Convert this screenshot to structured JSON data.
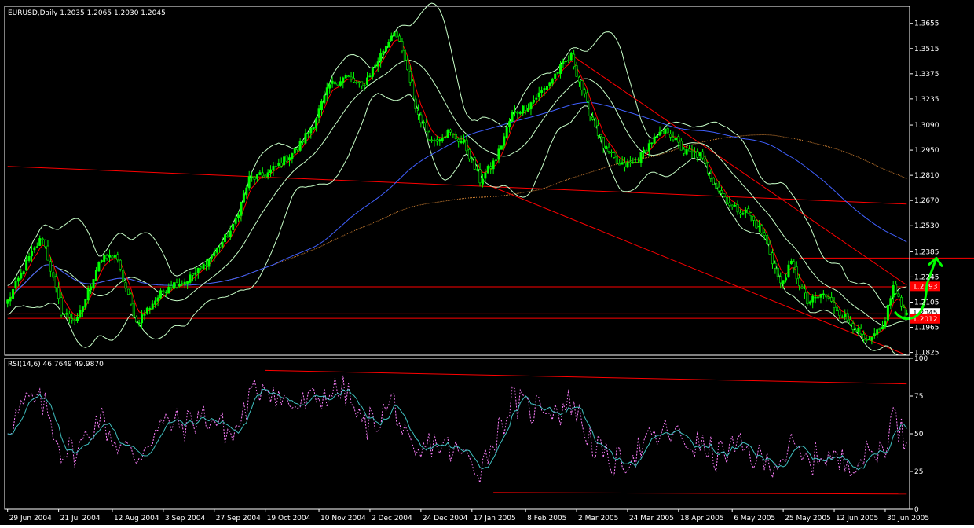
{
  "window": {
    "title": "EURUSD,Daily  1.2035 1.2065 1.2030 1.2045"
  },
  "colors": {
    "background": "#000000",
    "frame": "#ffffff",
    "axis_text": "#ffffff",
    "bull_candle": "#00ff00",
    "bear_candle": "#000000",
    "candle_outline": "#00ff00",
    "bollinger": "#c8ffc8",
    "ema_fast": "#ff0000",
    "ma_slow": "#4060ff",
    "ma_slowest": "#cd7f32",
    "trendline": "#ff0000",
    "rsi_main": "#40c0c0",
    "rsi_signal": "#ff80ff",
    "price_tag_bg": "#ff0000",
    "annotation": "#00ff00"
  },
  "chart_data": [
    {
      "type": "candlestick",
      "symbol": "EURUSD",
      "timeframe": "Daily",
      "title": "EURUSD,Daily  1.2035 1.2065 1.2030 1.2045",
      "last_bar": {
        "open": 1.2035,
        "high": 1.2065,
        "low": 1.203,
        "close": 1.2045
      },
      "x_tick_labels": [
        "29 Jun 2004",
        "21 Jul 2004",
        "12 Aug 2004",
        "3 Sep 2004",
        "27 Sep 2004",
        "19 Oct 2004",
        "10 Nov 2004",
        "2 Dec 2004",
        "24 Dec 2004",
        "17 Jan 2005",
        "8 Feb 2005",
        "2 Mar 2005",
        "24 Mar 2005",
        "18 Apr 2005",
        "6 May 2005",
        "25 May 2005",
        "12 Jun 2005",
        "30 Jun 2005"
      ],
      "y_tick_labels": [
        "1.3655",
        "1.3515",
        "1.3375",
        "1.3235",
        "1.3090",
        "1.2950",
        "1.2810",
        "1.2670",
        "1.2530",
        "1.2385",
        "1.2245",
        "1.2105",
        "1.1965",
        "1.1825"
      ],
      "ylim": [
        1.181,
        1.375
      ],
      "price_tags": [
        "1.2193",
        "1.2045",
        "1.2012"
      ],
      "anchors": [
        [
          0,
          1.211
        ],
        [
          8,
          1.235
        ],
        [
          13,
          1.247
        ],
        [
          20,
          1.205
        ],
        [
          26,
          1.2
        ],
        [
          34,
          1.233
        ],
        [
          40,
          1.237
        ],
        [
          48,
          1.199
        ],
        [
          54,
          1.21
        ],
        [
          60,
          1.22
        ],
        [
          66,
          1.222
        ],
        [
          72,
          1.229
        ],
        [
          78,
          1.24
        ],
        [
          84,
          1.252
        ],
        [
          90,
          1.279
        ],
        [
          96,
          1.281
        ],
        [
          102,
          1.288
        ],
        [
          108,
          1.296
        ],
        [
          114,
          1.31
        ],
        [
          120,
          1.331
        ],
        [
          126,
          1.336
        ],
        [
          132,
          1.33
        ],
        [
          138,
          1.345
        ],
        [
          144,
          1.362
        ],
        [
          148,
          1.345
        ],
        [
          152,
          1.318
        ],
        [
          158,
          1.3
        ],
        [
          164,
          1.305
        ],
        [
          170,
          1.299
        ],
        [
          176,
          1.278
        ],
        [
          182,
          1.29
        ],
        [
          188,
          1.315
        ],
        [
          194,
          1.32
        ],
        [
          200,
          1.329
        ],
        [
          206,
          1.341
        ],
        [
          210,
          1.347
        ],
        [
          216,
          1.32
        ],
        [
          222,
          1.297
        ],
        [
          228,
          1.286
        ],
        [
          234,
          1.288
        ],
        [
          240,
          1.3
        ],
        [
          246,
          1.306
        ],
        [
          252,
          1.294
        ],
        [
          258,
          1.292
        ],
        [
          264,
          1.275
        ],
        [
          270,
          1.263
        ],
        [
          276,
          1.26
        ],
        [
          282,
          1.247
        ],
        [
          288,
          1.22
        ],
        [
          292,
          1.232
        ],
        [
          298,
          1.21
        ],
        [
          304,
          1.215
        ],
        [
          310,
          1.205
        ],
        [
          316,
          1.196
        ],
        [
          320,
          1.187
        ],
        [
          326,
          1.196
        ],
        [
          330,
          1.219
        ],
        [
          334,
          1.2045
        ]
      ],
      "trendlines": [
        {
          "name": "descending-resistance",
          "p1": [
            210,
            1.348
          ],
          "p2": [
            335,
            1.22
          ]
        },
        {
          "name": "descending-support",
          "p1": [
            180,
            1.275
          ],
          "p2": [
            335,
            1.181
          ]
        },
        {
          "name": "long-horizontal-top",
          "p1": [
            0,
            1.286
          ],
          "p2": [
            335,
            1.265
          ]
        },
        {
          "name": "horizontal-upper",
          "p1": [
            295,
            1.235
          ],
          "p2": [
            360,
            1.235
          ]
        },
        {
          "name": "horizontal-mid",
          "p1": [
            0,
            1.219
          ],
          "p2": [
            335,
            1.219
          ]
        },
        {
          "name": "horizontal-low-1",
          "p1": [
            0,
            1.204
          ],
          "p2": [
            335,
            1.204
          ]
        },
        {
          "name": "horizontal-low-2",
          "p1": [
            0,
            1.2015
          ],
          "p2": [
            335,
            1.2015
          ]
        }
      ]
    },
    {
      "type": "line",
      "title": "RSI(14,6)  46.7649  49.9870",
      "name": "RSI(14,6)",
      "values_shown": [
        "46.7649",
        "49.9870"
      ],
      "y_tick_labels": [
        "100",
        "75",
        "50",
        "25",
        "0"
      ],
      "ylim": [
        0,
        100
      ],
      "anchors": [
        [
          0,
          55
        ],
        [
          8,
          72
        ],
        [
          14,
          68
        ],
        [
          20,
          40
        ],
        [
          26,
          38
        ],
        [
          34,
          62
        ],
        [
          40,
          45
        ],
        [
          48,
          34
        ],
        [
          54,
          50
        ],
        [
          60,
          58
        ],
        [
          66,
          55
        ],
        [
          72,
          62
        ],
        [
          78,
          58
        ],
        [
          84,
          48
        ],
        [
          90,
          72
        ],
        [
          96,
          85
        ],
        [
          102,
          72
        ],
        [
          108,
          68
        ],
        [
          114,
          72
        ],
        [
          120,
          78
        ],
        [
          126,
          78
        ],
        [
          132,
          55
        ],
        [
          138,
          60
        ],
        [
          144,
          72
        ],
        [
          148,
          45
        ],
        [
          152,
          30
        ],
        [
          158,
          45
        ],
        [
          164,
          40
        ],
        [
          170,
          35
        ],
        [
          176,
          28
        ],
        [
          182,
          48
        ],
        [
          188,
          72
        ],
        [
          194,
          65
        ],
        [
          200,
          70
        ],
        [
          206,
          65
        ],
        [
          210,
          72
        ],
        [
          216,
          50
        ],
        [
          222,
          34
        ],
        [
          228,
          30
        ],
        [
          234,
          38
        ],
        [
          240,
          45
        ],
        [
          246,
          52
        ],
        [
          252,
          45
        ],
        [
          258,
          42
        ],
        [
          264,
          35
        ],
        [
          270,
          40
        ],
        [
          276,
          38
        ],
        [
          282,
          30
        ],
        [
          288,
          34
        ],
        [
          292,
          40
        ],
        [
          298,
          30
        ],
        [
          304,
          38
        ],
        [
          310,
          30
        ],
        [
          316,
          34
        ],
        [
          320,
          35
        ],
        [
          326,
          40
        ],
        [
          330,
          62
        ],
        [
          334,
          47
        ]
      ],
      "trendlines": [
        {
          "name": "rsi-resistance",
          "p1": [
            96,
            92
          ],
          "p2": [
            335,
            83
          ]
        },
        {
          "name": "rsi-support",
          "p1": [
            181,
            11
          ],
          "p2": [
            335,
            10
          ]
        }
      ]
    }
  ]
}
